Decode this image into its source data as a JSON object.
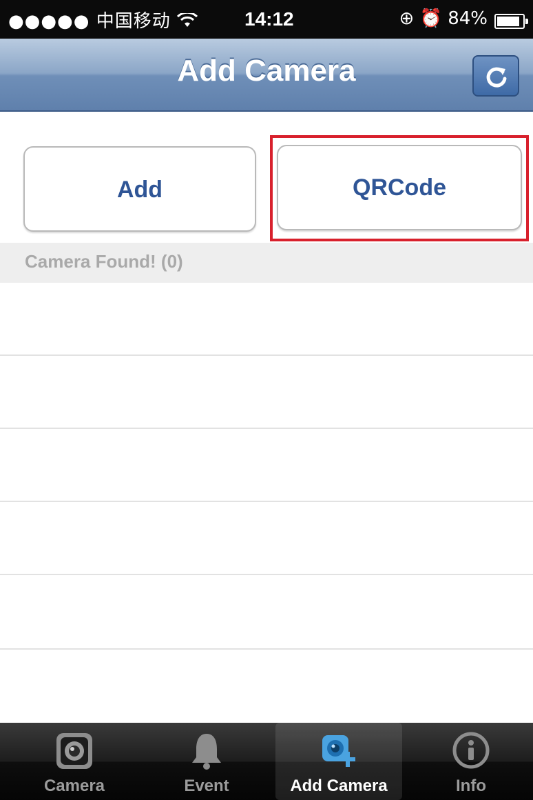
{
  "status_bar": {
    "carrier": "●●●●● 中国移动",
    "time": "14:12",
    "battery": "84%",
    "battery_level": 0.84
  },
  "nav": {
    "title": "Add Camera",
    "refresh_icon": "refresh-icon"
  },
  "buttons": {
    "add_label": "Add",
    "qrcode_label": "QRCode"
  },
  "section": {
    "found_label": "Camera Found! (0)"
  },
  "tabs": [
    {
      "label": "Camera",
      "icon": "camera-icon",
      "active": false
    },
    {
      "label": "Event",
      "icon": "bell-icon",
      "active": false
    },
    {
      "label": "Add Camera",
      "icon": "add-camera-icon",
      "active": true
    },
    {
      "label": "Info",
      "icon": "info-icon",
      "active": false
    }
  ],
  "colors": {
    "accent": "#2f5596",
    "highlight": "#d8202c",
    "nav_bar": "#7b98c0"
  }
}
